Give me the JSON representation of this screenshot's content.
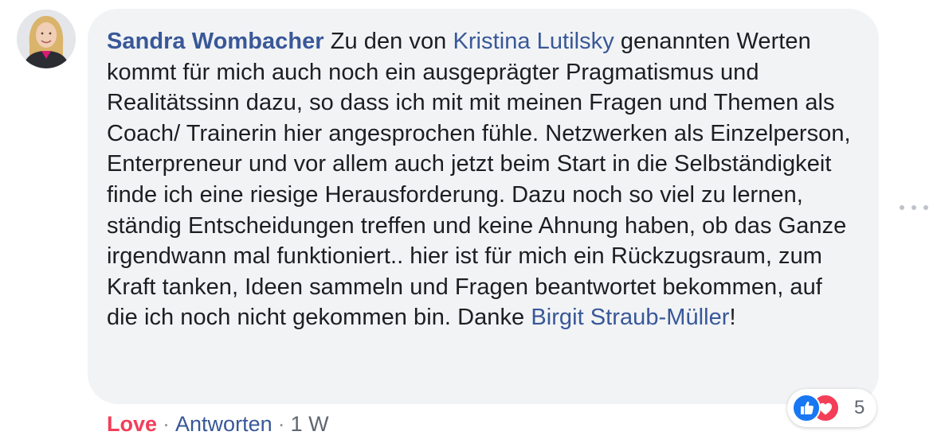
{
  "comment": {
    "author": "Sandra Wombacher",
    "text_parts": [
      " Zu den von ",
      " genannten Werten kommt für mich auch noch ein ausgeprägter Pragmatismus und Realitätssinn dazu, so dass ich mit mit meinen Fragen und Themen als Coach/ Trainerin hier angesprochen fühle. Netzwerken als Einzelperson, Enterpreneur und vor allem auch jetzt beim Start in die Selbständigkeit finde ich eine riesige Herausforderung. Dazu noch so viel zu lernen, ständig Entscheidungen treffen und keine Ahnung haben, ob das Ganze irgendwann mal funktioniert.. hier ist für mich ein Rückzugsraum, zum Kraft tanken, Ideen sammeln und Fragen beantwortet bekommen, auf die ich noch nicht gekommen bin. Danke ",
      "!"
    ],
    "mentions": [
      "Kristina Lutilsky",
      "Birgit Straub-Müller"
    ]
  },
  "reactions": {
    "icons": [
      "like-icon",
      "love-icon"
    ],
    "count": "5"
  },
  "actions": {
    "love_label": "Love",
    "reply_label": "Antworten",
    "separator": "·",
    "timestamp": "1 W"
  },
  "colors": {
    "link": "#385898",
    "love": "#f33e58",
    "like": "#1877f2",
    "bubble": "#f2f3f5",
    "meta": "#606770"
  }
}
